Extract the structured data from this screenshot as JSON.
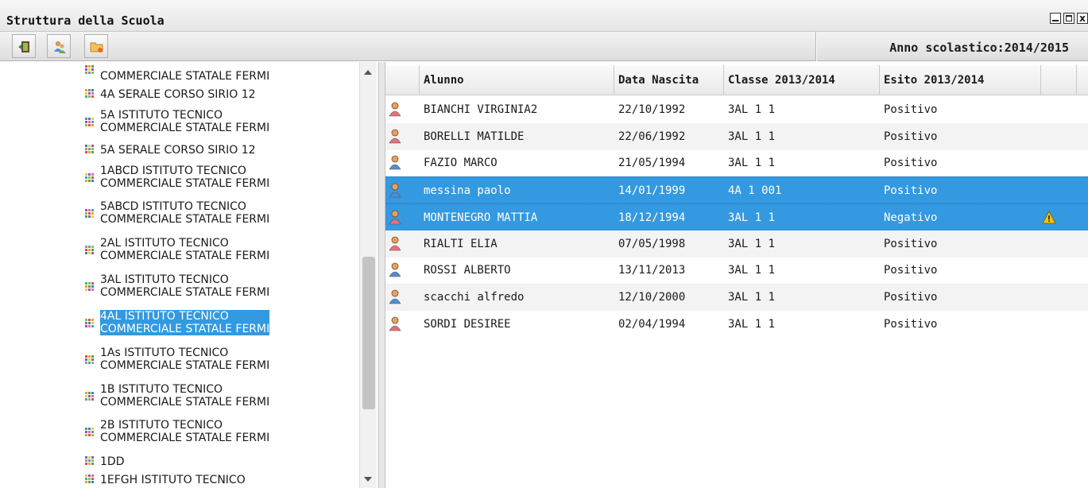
{
  "window": {
    "title": "Struttura della Scuola",
    "min_icon": "minimize-icon",
    "max_icon": "maximize-icon",
    "close_label": "x"
  },
  "toolbar": {
    "buttons": [
      {
        "name": "exit-icon"
      },
      {
        "name": "users-icon"
      },
      {
        "name": "folder-icon"
      }
    ],
    "year_label": "Anno scolastico:2014/2015"
  },
  "tree": {
    "items": [
      {
        "label": "COMMERCIALE STATALE FERMI",
        "selected": false
      },
      {
        "label": "4A SERALE CORSO SIRIO 12",
        "selected": false
      },
      {
        "label": "5A ISTITUTO TECNICO\nCOMMERCIALE STATALE FERMI",
        "selected": false
      },
      {
        "label": "5A SERALE CORSO SIRIO 12",
        "selected": false
      },
      {
        "label": "1ABCD ISTITUTO TECNICO\nCOMMERCIALE STATALE FERMI",
        "selected": false
      },
      {
        "label": "5ABCD ISTITUTO TECNICO\nCOMMERCIALE STATALE FERMI",
        "selected": false
      },
      {
        "label": "2AL ISTITUTO TECNICO\nCOMMERCIALE STATALE FERMI",
        "selected": false
      },
      {
        "label": "3AL ISTITUTO TECNICO\nCOMMERCIALE STATALE FERMI",
        "selected": false
      },
      {
        "label": "4AL ISTITUTO TECNICO\nCOMMERCIALE STATALE FERMI",
        "selected": true
      },
      {
        "label": "1As ISTITUTO TECNICO\nCOMMERCIALE STATALE FERMI",
        "selected": false
      },
      {
        "label": "1B ISTITUTO TECNICO\nCOMMERCIALE STATALE FERMI",
        "selected": false
      },
      {
        "label": "2B ISTITUTO TECNICO\nCOMMERCIALE STATALE FERMI",
        "selected": false
      },
      {
        "label": "1DD",
        "selected": false
      },
      {
        "label": "1EFGH ISTITUTO TECNICO",
        "selected": false
      }
    ]
  },
  "grid": {
    "columns": [
      "",
      "Alunno",
      "Data Nascita",
      "Classe 2013/2014",
      "Esito 2013/2014",
      ""
    ],
    "rows": [
      {
        "gender": "female",
        "alunno": "BIANCHI VIRGINIA2",
        "nascita": "22/10/1992",
        "classe": "3AL 1 1",
        "esito": "Positivo",
        "selected": false,
        "warning": false
      },
      {
        "gender": "female",
        "alunno": "BORELLI MATILDE",
        "nascita": "22/06/1992",
        "classe": "3AL 1 1",
        "esito": "Positivo",
        "selected": false,
        "warning": false
      },
      {
        "gender": "male",
        "alunno": "FAZIO MARCO",
        "nascita": "21/05/1994",
        "classe": "3AL 1 1",
        "esito": "Positivo",
        "selected": false,
        "warning": false
      },
      {
        "gender": "male",
        "alunno": "messina paolo",
        "nascita": "14/01/1999",
        "classe": "4A 1 001",
        "esito": "Positivo",
        "selected": true,
        "warning": false
      },
      {
        "gender": "female",
        "alunno": "MONTENEGRO MATTIA",
        "nascita": "18/12/1994",
        "classe": "3AL 1 1",
        "esito": "Negativo",
        "selected": true,
        "warning": true
      },
      {
        "gender": "female",
        "alunno": "RIALTI ELIA",
        "nascita": "07/05/1998",
        "classe": "3AL 1 1",
        "esito": "Positivo",
        "selected": false,
        "warning": false
      },
      {
        "gender": "male",
        "alunno": "ROSSI ALBERTO",
        "nascita": "13/11/2013",
        "classe": "3AL 1 1",
        "esito": "Positivo",
        "selected": false,
        "warning": false
      },
      {
        "gender": "male",
        "alunno": "scacchi alfredo",
        "nascita": "12/10/2000",
        "classe": "3AL 1 1",
        "esito": "Positivo",
        "selected": false,
        "warning": false
      },
      {
        "gender": "female",
        "alunno": "SORDI DESIREE",
        "nascita": "02/04/1994",
        "classe": "3AL 1 1",
        "esito": "Positivo",
        "selected": false,
        "warning": false
      }
    ]
  },
  "colors": {
    "selection": "#3399e0",
    "female": "#e8707a",
    "male": "#4f8fd6",
    "warning": "#f2c21b"
  }
}
